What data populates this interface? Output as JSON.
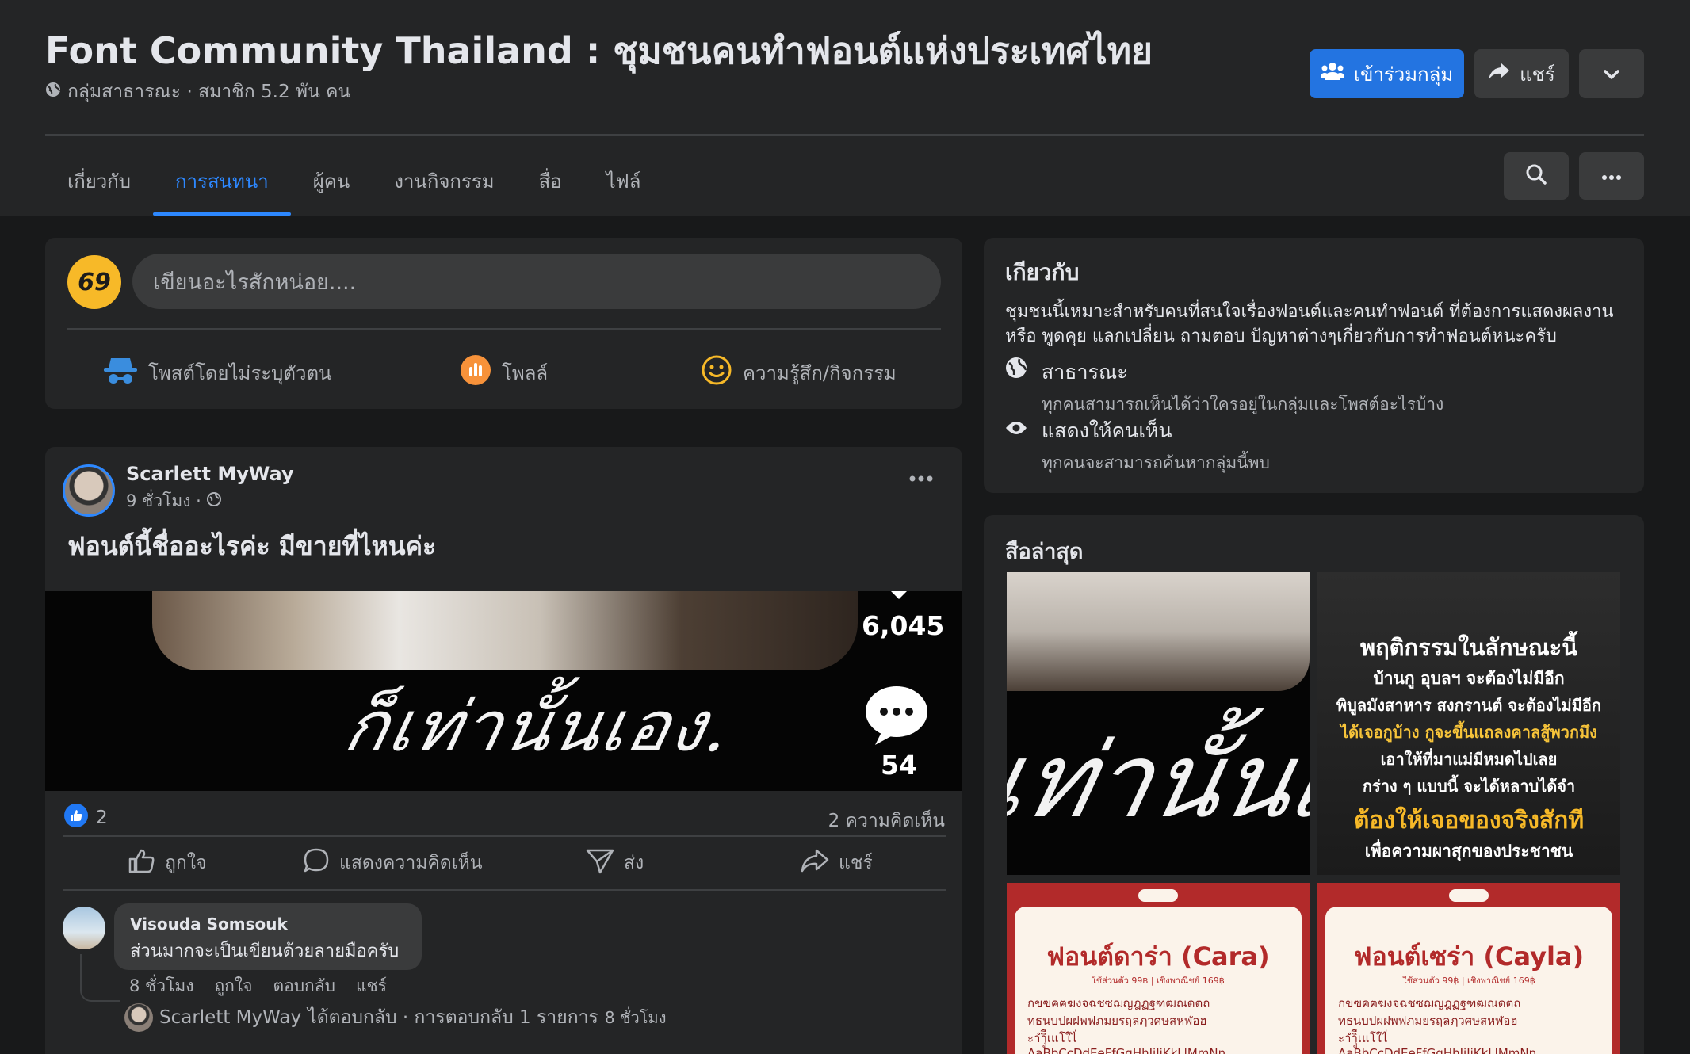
{
  "header": {
    "title": "Font Community Thailand : ชุมชนคนทำฟอนต์แห่งประเทศไทย",
    "meta": "กลุ่มสาธารณะ · สมาชิก 5.2 พัน คน",
    "join_label": "เข้าร่วมกลุ่ม",
    "share_label": "แชร์"
  },
  "tabs": [
    {
      "label": "เกี่ยวกับ",
      "active": false
    },
    {
      "label": "การสนทนา",
      "active": true
    },
    {
      "label": "ผู้คน",
      "active": false
    },
    {
      "label": "งานกิจกรรม",
      "active": false
    },
    {
      "label": "สื่อ",
      "active": false
    },
    {
      "label": "ไฟล์",
      "active": false
    }
  ],
  "composer": {
    "avatar_text": "69",
    "placeholder": "เขียนอะไรสักหน่อย....",
    "actions": [
      "โพสต์โดยไม่ระบุตัวตน",
      "โพลล์",
      "ความรู้สึก/กิจกรรม"
    ]
  },
  "post": {
    "author": "Scarlett MyWay",
    "time": "9 ชั่วโมง ·",
    "text": "ฟอนต์นี้ชื่ออะไรค่ะ มีขายที่ไหนค่ะ",
    "media_script": "ก็เท่านั้นเอง.",
    "media_likes": "6,045",
    "media_comments": "54",
    "reaction_count": "2",
    "comment_count": "2 ความคิดเห็น",
    "actions": [
      "ถูกใจ",
      "แสดงความคิดเห็น",
      "ส่ง",
      "แชร์"
    ]
  },
  "comment": {
    "author": "Visouda Somsouk",
    "text": "ส่วนมากจะเป็นเขียนด้วยลายมือครับ",
    "time": "8 ชั่วโมง",
    "like": "ถูกใจ",
    "reply": "ตอบกลับ",
    "share": "แชร์",
    "reply_summary_author": "Scarlett MyWay",
    "reply_summary_text": "ได้ตอบกลับ · การตอบกลับ 1 รายการ",
    "reply_summary_time": "8 ชั่วโมง"
  },
  "about": {
    "heading": "เกียวกับ",
    "description": "ชุมชนนี้เหมาะสำหรับคนที่สนใจเรื่องฟอนต์และคนทำฟอนต์ ที่ต้องการแสดงผลงาน หรือ พูดคุย แลกเปลี่ยน ถามตอบ ปัญหาต่างๆเกี่ยวกับการทำฟอนต์หนะครับ",
    "public_title": "สาธารณะ",
    "public_desc": "ทุกคนสามารถเห็นได้ว่าใครอยู่ในกลุ่มและโพสต์อะไรบ้าง",
    "visible_title": "แสดงให้คนเห็น",
    "visible_desc": "ทุกคนจะสามารถค้นหากลุ่มนี้พบ"
  },
  "media": {
    "heading": "สือล่าสุด",
    "thumb1_script": "เท่านั้นเอ",
    "thumb2_lines": [
      "พฤติกรรมในลักษณะนี้",
      "บ้านกู อุบลฯ จะต้องไม่มีอีก",
      "พิบูลมังสาหาร สงกรานต์ จะต้องไม่มีอีก",
      "ได้เจอกูบ้าง กูจะขึ้นแถลงคาลสู้พวกมึง",
      "เอาให้ที่มาแม่มีหมดไปเลย",
      "กร่าง ๆ แบบนี้ จะได้หลาบได้จำ",
      "ต้องให้เจอของจริงสักที",
      "เพื่อความผาสุกของประชาชน"
    ],
    "thumb3_title": "ฟอนต์ดาร่า (Cara)",
    "thumb4_title": "ฟอนต์เซร่า (Cayla)",
    "sheet_sub": "ใช้ส่วนตัว 99฿ | เชิงพาณิชย์ 169฿",
    "sheet_line1": "กขฃคฅฆงจฉชซฌญฎฏฐฑฒณดตถ",
    "sheet_line2": "ทธนบปผฝพฟภมยรฤลฦวศษสหฬอฮ",
    "sheet_line3": "ะาำิีึืุูเแโใไ่้๊๋็์",
    "sheet_line4": "AaBbCcDdEeFfGgHhIiJjKkLlMmNn"
  },
  "colors": {
    "page_bg": "#18191a",
    "card_bg": "#242526",
    "accent": "#2d88ff",
    "join_button": "#2374e1"
  }
}
